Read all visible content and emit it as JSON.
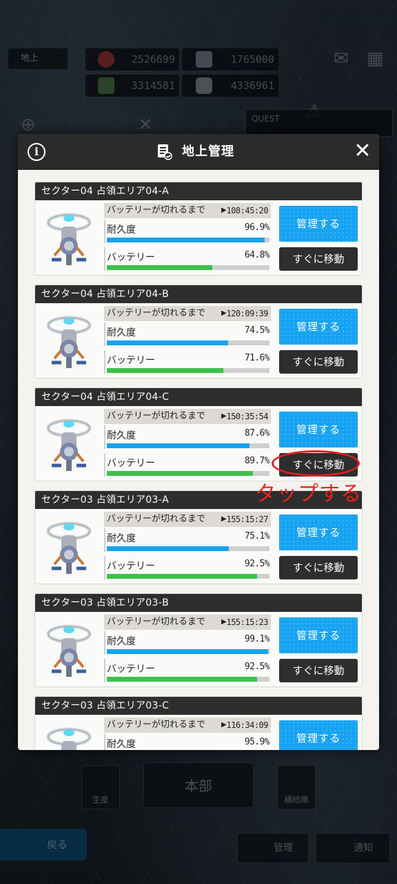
{
  "background": {
    "location_label": "地上",
    "resources": [
      "2526699",
      "1765000",
      "3314581",
      "4336961"
    ],
    "quest_label": "QUEST",
    "hq_label": "本部",
    "left_building": "生産",
    "right_building": "補給庫",
    "back_label": "戻る",
    "manage_label": "管理",
    "notify_label": "通知"
  },
  "modal": {
    "title": "地上管理",
    "timer_label": "バッテリーが切れるまで",
    "durability_label": "耐久度",
    "battery_label": "バッテリー",
    "manage_button": "管理する",
    "move_button": "すぐに移動",
    "cards": [
      {
        "title": "セクター04 占領エリア04-A",
        "timer": "108:45:20",
        "durability": "96.9%",
        "durability_pct": 96.9,
        "battery": "64.8%",
        "battery_pct": 64.8
      },
      {
        "title": "セクター04 占領エリア04-B",
        "timer": "120:09:39",
        "durability": "74.5%",
        "durability_pct": 74.5,
        "battery": "71.6%",
        "battery_pct": 71.6
      },
      {
        "title": "セクター04 占領エリア04-C",
        "timer": "150:35:54",
        "durability": "87.6%",
        "durability_pct": 87.6,
        "battery": "89.7%",
        "battery_pct": 89.7
      },
      {
        "title": "セクター03 占領エリア03-A",
        "timer": "155:15:27",
        "durability": "75.1%",
        "durability_pct": 75.1,
        "battery": "92.5%",
        "battery_pct": 92.5
      },
      {
        "title": "セクター03 占領エリア03-B",
        "timer": "155:15:23",
        "durability": "99.1%",
        "durability_pct": 99.1,
        "battery": "92.5%",
        "battery_pct": 92.5
      },
      {
        "title": "セクター03 占領エリア03-C",
        "timer": "116:34:09",
        "durability": "95.9%",
        "durability_pct": 95.9,
        "battery": "",
        "battery_pct": 0
      }
    ]
  },
  "annotation": {
    "text": "タップする",
    "color": "#e8231d"
  },
  "colors": {
    "accent_blue": "#17a3f2",
    "battery_green": "#3cc04a",
    "header_dark": "#2b2b2b"
  }
}
